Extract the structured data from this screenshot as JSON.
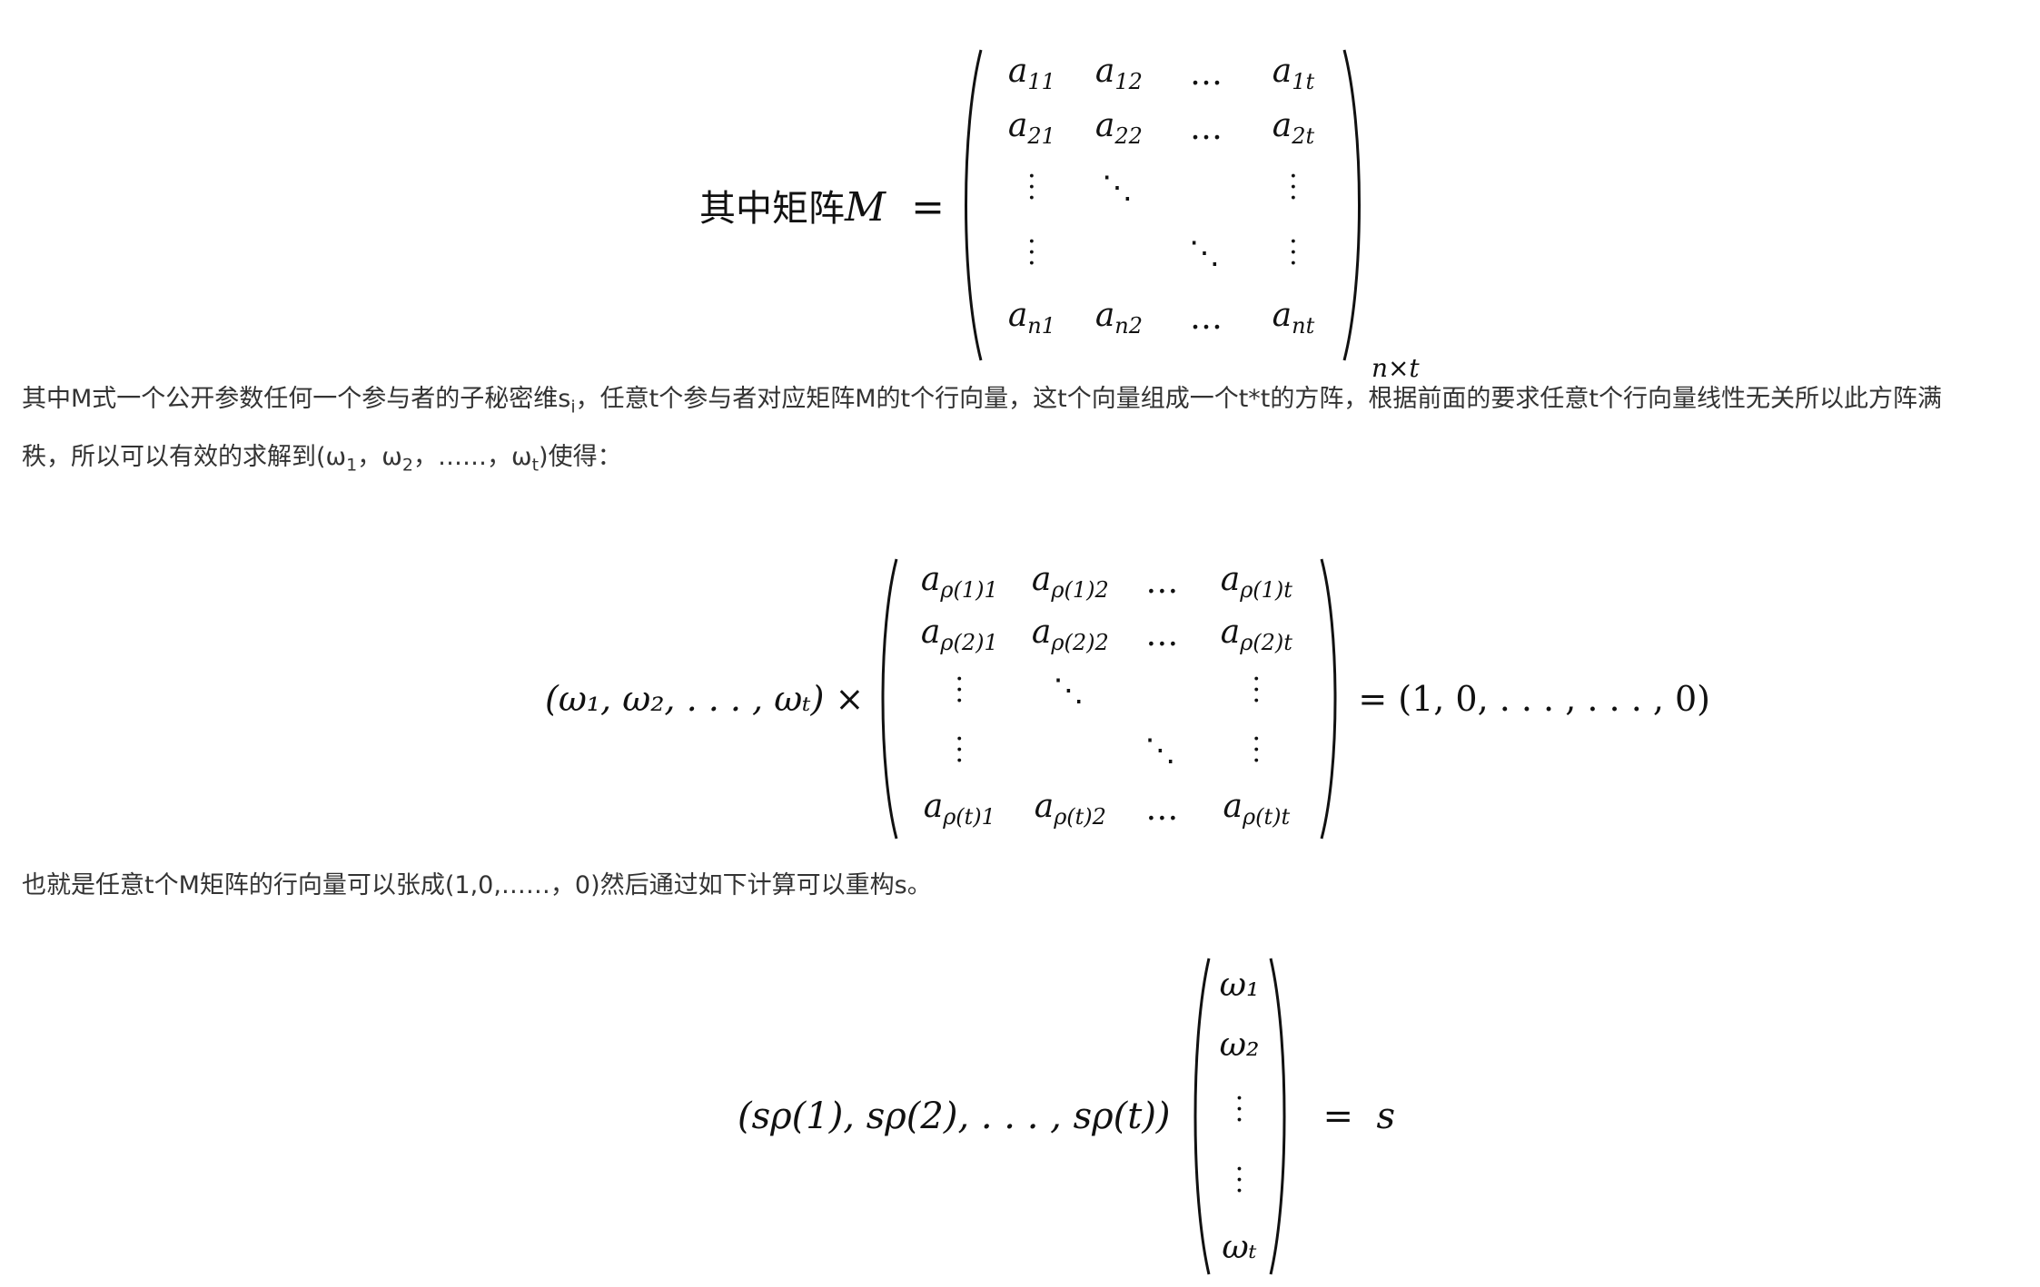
{
  "eq1": {
    "lhs": "其中矩阵",
    "var": "M",
    "eq": "=",
    "cells": [
      [
        "a",
        "11",
        "a",
        "12",
        "…",
        "",
        "a",
        "1t"
      ],
      [
        "a",
        "21",
        "a",
        "22",
        "…",
        "",
        "a",
        "2t"
      ]
    ],
    "r1c1": "a",
    "r1c1s": "11",
    "r1c2": "a",
    "r1c2s": "12",
    "r1c3": "…",
    "r1c4": "a",
    "r1c4s": "1t",
    "r2c1": "a",
    "r2c1s": "21",
    "r2c2": "a",
    "r2c2s": "22",
    "r2c3": "…",
    "r2c4": "a",
    "r2c4s": "2t",
    "r5c1": "a",
    "r5c1s": "n1",
    "r5c2": "a",
    "r5c2s": "n2",
    "r5c3": "…",
    "r5c4": "a",
    "r5c4s": "nt",
    "size": "n×t"
  },
  "para1": {
    "text_a": "其中M式一个公开参数任何一个参与者的子秘密维s",
    "sub_i": "i",
    "text_b": "，任意t个参与者对应矩阵M的t个行向量，这t个向量组成一个t*t的方阵，根据前面的要求任意t个行向量线性无关所以此方阵满",
    "text_c": "秩，所以可以有效的求解到(ω",
    "sub_1": "1",
    "text_d": "，ω",
    "sub_2": "2",
    "text_e": "，……，ω",
    "sub_t": "t",
    "text_f": ")使得："
  },
  "eq2": {
    "lhs": "(ω₁, ω₂, . . . , ωₜ) ×",
    "r1": [
      "a",
      "ρ(1)1",
      "a",
      "ρ(1)2",
      "…",
      "a",
      "ρ(1)t"
    ],
    "r2": [
      "a",
      "ρ(2)1",
      "a",
      "ρ(2)2",
      "…",
      "a",
      "ρ(2)t"
    ],
    "r5": [
      "a",
      "ρ(t)1",
      "a",
      "ρ(t)2",
      "…",
      "a",
      "ρ(t)t"
    ],
    "rhs": "= (1, 0, . . . , . . . , 0)"
  },
  "para2": {
    "text": "也就是任意t个M矩阵的行向量可以张成(1,0,……，0)然后通过如下计算可以重构s。"
  },
  "eq3": {
    "lhs": "(s",
    "lhs_full": "(sρ(1), sρ(2), . . . , sρ(t))",
    "vec": [
      "ω₁",
      "ω₂",
      "ωₜ"
    ],
    "rhs": "=  s"
  }
}
